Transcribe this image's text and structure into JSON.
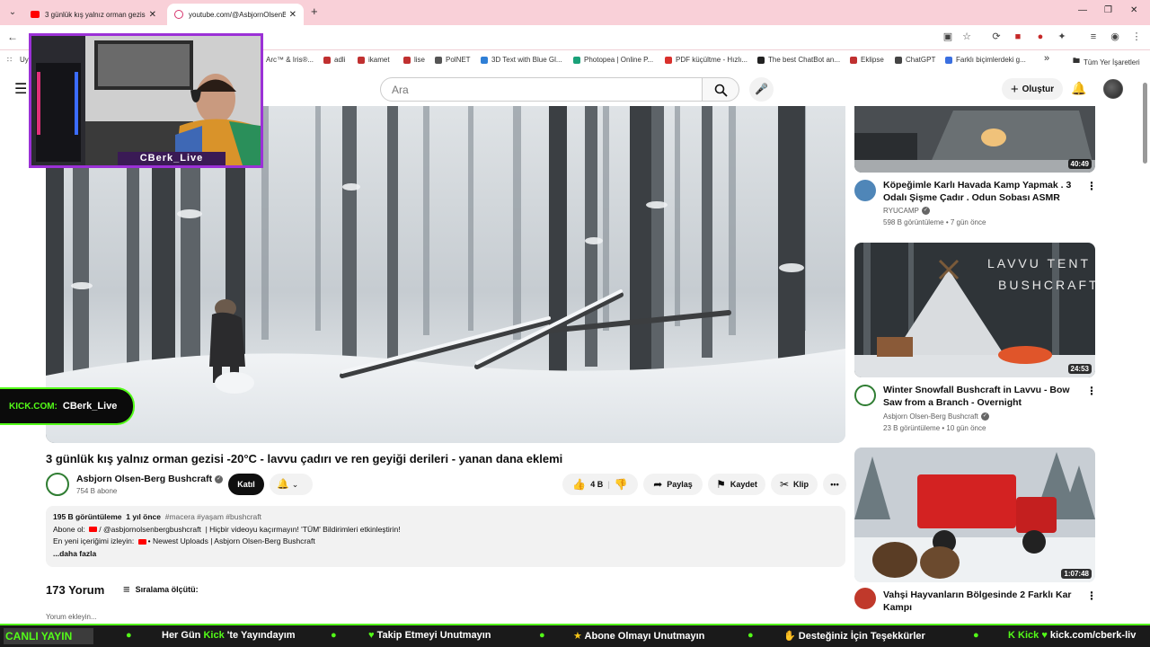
{
  "browser": {
    "tabs": [
      {
        "title": "3 günlük kış yalnız orman gezisi",
        "close": "✕"
      },
      {
        "title": "youtube.com/@AsbjornOlsenB...",
        "close": "✕"
      }
    ],
    "tab_list": "⌄",
    "new_tab": "+",
    "window_controls": {
      "minimize": "—",
      "restore": "❐",
      "close": "✕"
    },
    "bookmarks": [
      {
        "label": "Uy",
        "color": "#888888"
      },
      {
        "label": "Arc™ & Iris®...",
        "color": "#888888"
      },
      {
        "label": "adli",
        "color": "#c03030"
      },
      {
        "label": "ikamet",
        "color": "#c03030"
      },
      {
        "label": "lise",
        "color": "#c03030"
      },
      {
        "label": "PolNET",
        "color": "#555555"
      },
      {
        "label": "3D Text with Blue Gl...",
        "color": "#2f7fd6"
      },
      {
        "label": "Photopea | Online P...",
        "color": "#1aa179"
      },
      {
        "label": "PDF küçültme - Hızlı...",
        "color": "#d9302c"
      },
      {
        "label": "The best ChatBot an...",
        "color": "#222222"
      },
      {
        "label": "Eklipse",
        "color": "#c03030"
      },
      {
        "label": "ChatGPT",
        "color": "#444444"
      },
      {
        "label": "Farklı biçimlerdeki g...",
        "color": "#3a6fe0"
      }
    ],
    "bookmarks_overflow": "»",
    "all_bookmarks": "Tüm Yer İşaretleri"
  },
  "youtube": {
    "search_placeholder": "Ara",
    "create_label": "Oluştur"
  },
  "webcam": {
    "name": "CBerk_Live"
  },
  "kick_tag": {
    "label": "KICK.COM:",
    "name": "CBerk_Live"
  },
  "video": {
    "title": "3 günlük kış yalnız orman gezisi -20°C - lavvu çadırı ve ren geyiği derileri - yanan dana eklemi",
    "channel": "Asbjorn Olsen-Berg Bushcraft",
    "subscribers": "754 B abone",
    "join_label": "Katıl",
    "likes": "4 B",
    "share_label": "Paylaş",
    "save_label": "Kaydet",
    "clip_label": "Klip",
    "more_label": "•••"
  },
  "description": {
    "views": "195 B görüntüleme",
    "time": "1 yıl önce",
    "tags": "#macera #yaşam #bushcraft",
    "line2_label": "Abone ol:",
    "line2_link": "/ @asbjornolsenbergbushcraft",
    "line2_text": "| Hiçbir videoyu kaçırmayın! 'TÜM' Bildirimleri etkinleştirin!",
    "line3_label": "En yeni içeriğimi izleyin:",
    "line3_link": "• Newest Uploads | Asbjorn Olsen-Berg Bushcraft",
    "more": "...daha fazla"
  },
  "comments": {
    "count": "173 Yorum",
    "sort_label": "Sıralama ölçütü:",
    "add_placeholder": "Yorum ekleyin..."
  },
  "recommendations": [
    {
      "title": "Köpeğimle Karlı Havada Kamp Yapmak . 3 Odalı Şişme Çadır . Odun Sobası ASMR",
      "channel": "RYUCAMP",
      "meta": "598 B görüntüleme • 7 gün önce",
      "duration": "40:49"
    },
    {
      "title": "Winter Snowfall Bushcraft in Lavvu - Bow Saw from a Branch - Overnight",
      "channel": "Asbjorn Olsen-Berg Bushcraft",
      "meta": "23 B görüntüleme • 10 gün önce",
      "duration": "24:53",
      "thumb_text": "LAVVU TENT\nBUSHCRAFT"
    },
    {
      "title": "Vahşi Hayvanların Bölgesinde 2 Farklı Kar Kampı",
      "channel": "",
      "meta": "",
      "duration": "1:07:48"
    }
  ],
  "ticker": {
    "live": "CANLI YAYIN",
    "item1_a": "Her Gün",
    "item1_b": "Kick",
    "item1_c": "'te Yayındayım",
    "item2": "Takip Etmeyi Unutmayın",
    "item3": "Abone Olmayı Unutmayın",
    "item4": "Desteğiniz İçin Teşekkürler",
    "item5_a": "Kick",
    "item5_b": "kick.com/cberk-liv"
  },
  "colors": {
    "kick_green": "#53fc18",
    "webcam_border": "#9b31d6",
    "tabbar": "#f9d0d8"
  }
}
